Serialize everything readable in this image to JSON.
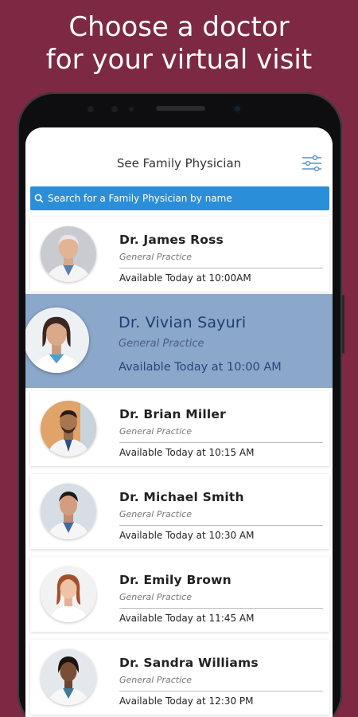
{
  "headline": {
    "line1": "Choose a doctor",
    "line2": "for your virtual visit"
  },
  "colors": {
    "background": "#7d2943",
    "search_bar": "#2b8ed8",
    "selected_row": "#8ba7c9"
  },
  "app": {
    "title": "See Family Physician",
    "filter_icon": "sliders-icon",
    "search": {
      "icon": "search-icon",
      "placeholder": "Search for a Family Physician by name"
    }
  },
  "doctors": [
    {
      "name": "Dr. James Ross",
      "specialty": "General Practice",
      "availability": "Available Today at 10:00AM",
      "selected": false
    },
    {
      "name": "Dr. Vivian Sayuri",
      "specialty": "General Practice",
      "availability": "Available Today at 10:00 AM",
      "selected": true
    },
    {
      "name": "Dr. Brian Miller",
      "specialty": "General Practice",
      "availability": "Available Today at 10:15 AM",
      "selected": false
    },
    {
      "name": "Dr. Michael Smith",
      "specialty": "General Practice",
      "availability": "Available Today at 10:30 AM",
      "selected": false
    },
    {
      "name": "Dr. Emily Brown",
      "specialty": "General Practice",
      "availability": "Available Today at 11:45 AM",
      "selected": false
    },
    {
      "name": "Dr. Sandra Williams",
      "specialty": "General Practice",
      "availability": "Available Today at 12:30 PM",
      "selected": false
    }
  ]
}
